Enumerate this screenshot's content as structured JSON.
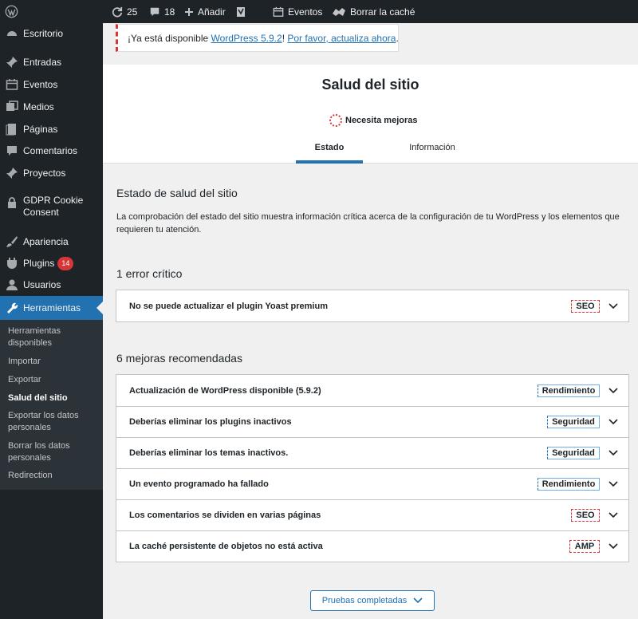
{
  "adminbar": {
    "updates_count": "25",
    "comments_count": "18",
    "add_new": "Añadir",
    "events": "Eventos",
    "clear_cache": "Borrar la caché"
  },
  "sidebar": {
    "items": [
      {
        "label": "Escritorio",
        "icon": "dashboard-icon"
      },
      {
        "label": "Entradas",
        "icon": "pin-icon"
      },
      {
        "label": "Eventos",
        "icon": "calendar-icon"
      },
      {
        "label": "Medios",
        "icon": "media-icon"
      },
      {
        "label": "Páginas",
        "icon": "page-icon"
      },
      {
        "label": "Comentarios",
        "icon": "comment-icon"
      },
      {
        "label": "Proyectos",
        "icon": "pin-icon"
      },
      {
        "label": "GDPR Cookie Consent",
        "icon": "lock-icon"
      },
      {
        "label": "Apariencia",
        "icon": "brush-icon"
      },
      {
        "label": "Plugins",
        "icon": "plugin-icon",
        "badge": "14"
      },
      {
        "label": "Usuarios",
        "icon": "user-icon"
      },
      {
        "label": "Herramientas",
        "icon": "wrench-icon"
      }
    ],
    "submenu": [
      "Herramientas disponibles",
      "Importar",
      "Exportar",
      "Salud del sitio",
      "Exportar los datos personales",
      "Borrar los datos personales",
      "Redirection"
    ]
  },
  "notice": {
    "prefix": "¡Ya está disponible ",
    "version_link": "WordPress 5.9.2",
    "middle": "! ",
    "update_link": "Por favor, actualiza ahora",
    "suffix": "."
  },
  "header": {
    "title": "Salud del sitio",
    "status": "Necesita mejoras",
    "tabs": [
      "Estado",
      "Información"
    ]
  },
  "main": {
    "heading": "Estado de salud del sitio",
    "description": "La comprobación del estado del sitio muestra información crítica acerca de la configuración de tu WordPress y los elementos que requieren tu atención.",
    "critical_heading": "1 error crítico",
    "critical_items": [
      {
        "title": "No se puede actualizar el plugin Yoast premium",
        "badge": "SEO"
      }
    ],
    "recommended_heading": "6 mejoras recomendadas",
    "recommended_items": [
      {
        "title": "Actualización de WordPress disponible (5.9.2)",
        "badge": "Rendimiento"
      },
      {
        "title": "Deberías eliminar los plugins inactivos",
        "badge": "Seguridad"
      },
      {
        "title": "Deberías eliminar los temas inactivos.",
        "badge": "Seguridad"
      },
      {
        "title": "Un evento programado ha fallado",
        "badge": "Rendimiento"
      },
      {
        "title": "Los comentarios se dividen en varias páginas",
        "badge": "SEO"
      },
      {
        "title": "La caché persistente de objetos no está activa",
        "badge": "AMP"
      }
    ],
    "completed_button": "Pruebas completadas"
  },
  "colors": {
    "accent": "#2271b1",
    "sidebar_bg": "#1d2327",
    "critical": "#d63638"
  }
}
